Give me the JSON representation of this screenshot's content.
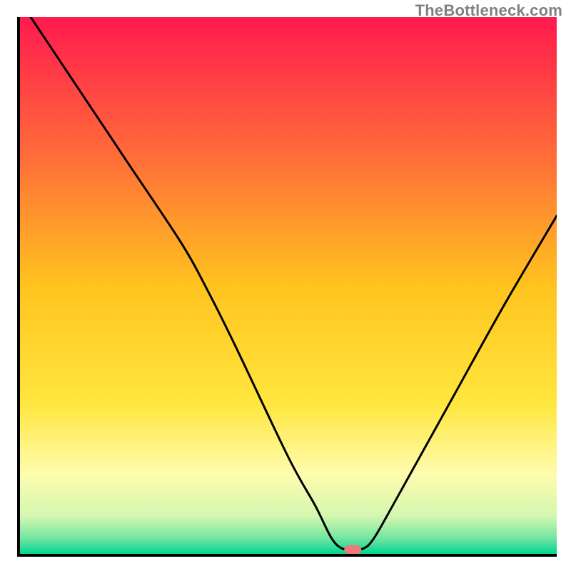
{
  "watermark": "TheBottleneck.com",
  "chart_data": {
    "type": "line",
    "title": "",
    "xlabel": "",
    "ylabel": "",
    "xlim": [
      0,
      100
    ],
    "ylim": [
      0,
      100
    ],
    "curve": {
      "name": "bottleneck-curve",
      "x": [
        2,
        10,
        20,
        30,
        35,
        40,
        50,
        55,
        58,
        60,
        62,
        64,
        66,
        70,
        80,
        90,
        100
      ],
      "y": [
        100,
        88,
        73,
        58,
        49,
        39,
        18,
        9,
        3,
        1,
        1,
        1,
        3,
        10,
        28,
        46,
        63
      ]
    },
    "marker": {
      "x": 62,
      "y": 0.8,
      "color": "#f07878"
    },
    "background": {
      "type": "vertical-gradient",
      "stops": [
        {
          "offset": 0.0,
          "color": "#ff1a4f"
        },
        {
          "offset": 0.25,
          "color": "#ff6a3a"
        },
        {
          "offset": 0.5,
          "color": "#ffc31f"
        },
        {
          "offset": 0.72,
          "color": "#ffe63e"
        },
        {
          "offset": 0.85,
          "color": "#fffcae"
        },
        {
          "offset": 0.93,
          "color": "#d4f7b0"
        },
        {
          "offset": 0.97,
          "color": "#75e6a2"
        },
        {
          "offset": 1.0,
          "color": "#00d68f"
        }
      ]
    }
  }
}
